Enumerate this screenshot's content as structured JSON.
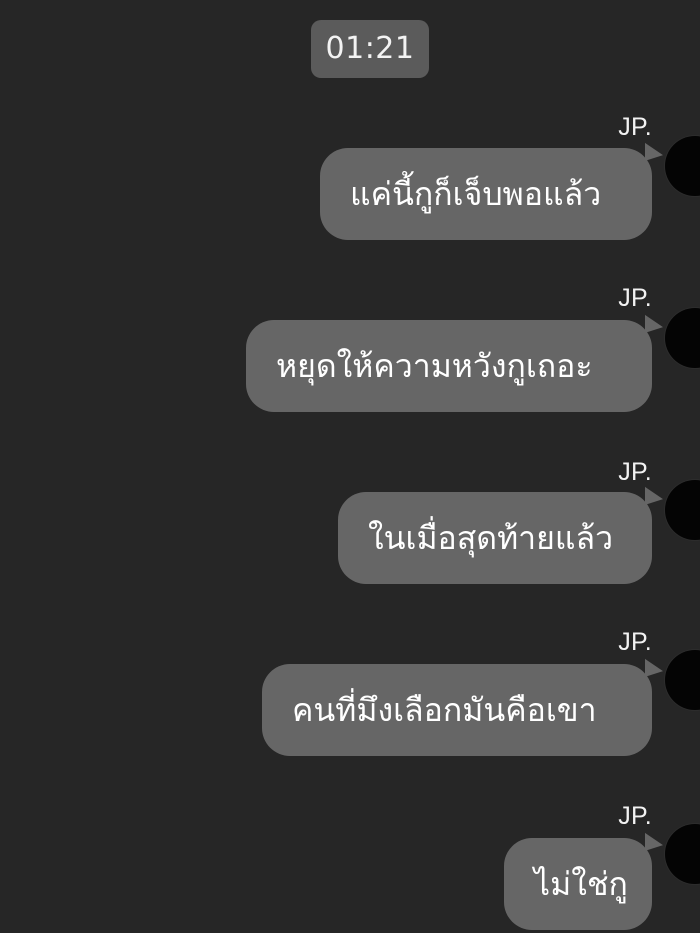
{
  "chat": {
    "time": "01:21",
    "messages": [
      {
        "sender": "JP.",
        "text": "แค่นี้กูก็เจ็บพอแล้ว"
      },
      {
        "sender": "JP.",
        "text": "หยุดให้ความหวังกูเถอะ"
      },
      {
        "sender": "JP.",
        "text": "ในเมื่อสุดท้ายแล้ว"
      },
      {
        "sender": "JP.",
        "text": "คนที่มึงเลือกมันคือเขา"
      },
      {
        "sender": "JP.",
        "text": "ไม่ใช่กู"
      }
    ]
  },
  "colors": {
    "background": "#262626",
    "bubble": "#666666",
    "time_chip": "#5b5b5b",
    "text": "#ffffff"
  }
}
